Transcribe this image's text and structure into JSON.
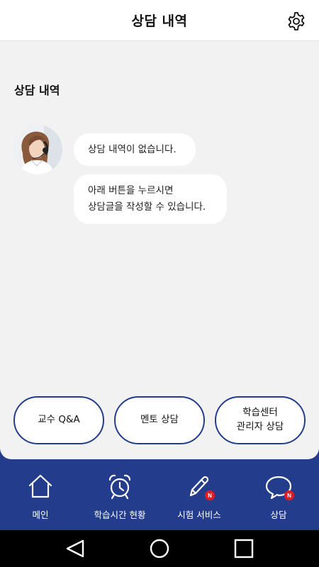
{
  "header": {
    "title": "상담 내역",
    "settings_icon": "gear-icon"
  },
  "section": {
    "title": "상담 내역"
  },
  "chat": {
    "bubble1": "상담 내역이 없습니다.",
    "bubble2_line1": "아래 버튼을 누르시면",
    "bubble2_line2": "상담글을 작성할 수 있습니다."
  },
  "actions": [
    {
      "label": "교수 Q&A"
    },
    {
      "label": "멘토 상담"
    },
    {
      "label": "학습센터\n관리자 상담"
    }
  ],
  "tabs": [
    {
      "label": "메인",
      "icon": "home-icon"
    },
    {
      "label": "학습시간 현황",
      "icon": "alarm-clock-icon"
    },
    {
      "label": "시험 서비스",
      "icon": "pencil-icon",
      "badge": "N"
    },
    {
      "label": "상담",
      "icon": "chat-bubble-icon",
      "badge": "N"
    }
  ],
  "colors": {
    "brand": "#233d8c",
    "badge": "#e01b24",
    "panel": "#f2f2f2"
  },
  "android_nav": {
    "back": "back-triangle-icon",
    "home": "home-circle-icon",
    "recents": "recents-square-icon"
  }
}
